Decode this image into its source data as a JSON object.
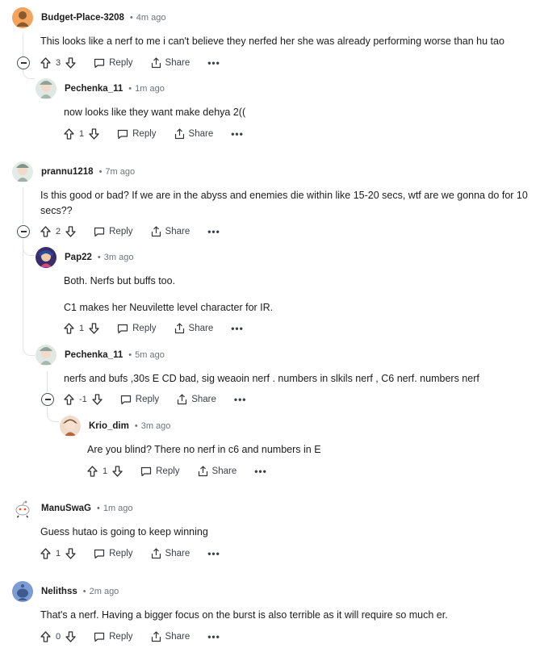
{
  "actions": {
    "reply_label": "Reply",
    "share_label": "Share",
    "more_label": "•••"
  },
  "comments": [
    {
      "author": "Budget-Place-3208",
      "time": "4m ago",
      "text": "This looks like a nerf to me i can't believe they nerfed her she was already performing worse than hu tao",
      "votes": "3"
    },
    {
      "author": "Pechenka_11",
      "time": "1m ago",
      "text": "now looks like they want make dehya 2((",
      "votes": "1"
    },
    {
      "author": "prannu1218",
      "time": "7m ago",
      "text": "Is this good or bad? If we are in the abyss and enemies die within like 15-20 secs, wtf are we gonna do for 10 secs??",
      "votes": "2"
    },
    {
      "author": "Pap22",
      "time": "3m ago",
      "text": "Both. Nerfs but buffs too.",
      "text2": "C1 makes her Neuvilette level character for IR.",
      "votes": "1"
    },
    {
      "author": "Pechenka_11",
      "time": "5m ago",
      "text": "nerfs and bufs ,30s E CD bad, sig weaoin nerf . numbers in slkils nerf , C6 nerf. numbers nerf",
      "votes": "-1"
    },
    {
      "author": "Krio_dim",
      "time": "3m ago",
      "text": "Are you blind? There no nerf in c6 and numbers in E",
      "votes": "1"
    },
    {
      "author": "ManuSwaG",
      "time": "1m ago",
      "text": "Guess hutao is going to keep winning",
      "votes": "1"
    },
    {
      "author": "Nelithss",
      "time": "2m ago",
      "text": "That's a nerf. Having a bigger focus on the burst is also terrible as it will require so much er.",
      "votes": "0"
    }
  ]
}
